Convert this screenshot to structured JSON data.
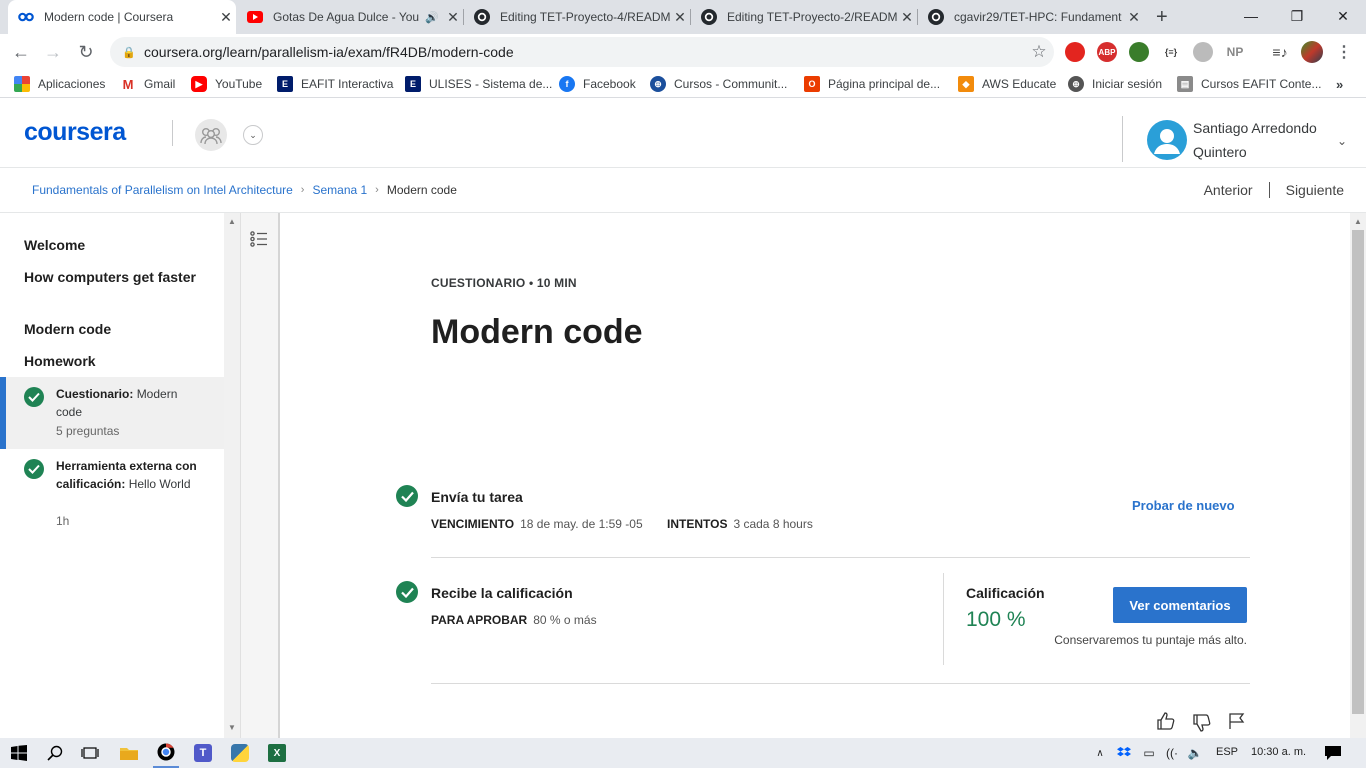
{
  "browser": {
    "tabs": [
      {
        "title": "Modern code | Coursera",
        "icon": "coursera-icon",
        "active": true
      },
      {
        "title": "Gotas De Agua Dulce - You",
        "icon": "youtube-icon",
        "audio": true
      },
      {
        "title": "Editing TET-Proyecto-4/READM",
        "icon": "github-icon"
      },
      {
        "title": "Editing TET-Proyecto-2/READM",
        "icon": "github-icon"
      },
      {
        "title": "cgavir29/TET-HPC: Fundament",
        "icon": "github-icon"
      }
    ],
    "url": "coursera.org/learn/parallelism-ia/exam/fR4DB/modern-code",
    "bookmarks": [
      {
        "label": "Aplicaciones",
        "icon": "apps-grid-icon"
      },
      {
        "label": "Gmail",
        "icon": "gmail-icon"
      },
      {
        "label": "YouTube",
        "icon": "youtube-icon"
      },
      {
        "label": "EAFIT Interactiva",
        "icon": "eafit-icon"
      },
      {
        "label": "ULISES - Sistema de...",
        "icon": "eafit-icon"
      },
      {
        "label": "Facebook",
        "icon": "facebook-icon"
      },
      {
        "label": "Cursos - Communit...",
        "icon": "globe-icon"
      },
      {
        "label": "Página principal de...",
        "icon": "office-icon"
      },
      {
        "label": "AWS Educate",
        "icon": "aws-icon"
      },
      {
        "label": "Iniciar sesión",
        "icon": "globe-icon"
      },
      {
        "label": "Cursos EAFIT Conte...",
        "icon": "page-icon"
      }
    ],
    "extensions": {
      "abp": "ABP",
      "np": "NP",
      "braces": "{≡}"
    }
  },
  "header": {
    "logo": "coursera",
    "user_name": "Santiago Arredondo Quintero"
  },
  "breadcrumb": {
    "course": "Fundamentals of Parallelism on Intel Architecture",
    "week": "Semana 1",
    "current": "Modern code"
  },
  "nav": {
    "prev": "Anterior",
    "next": "Siguiente"
  },
  "sidebar": {
    "sections": [
      "Welcome",
      "How computers get faster",
      "Modern code",
      "Homework"
    ],
    "items": [
      {
        "type": "Cuestionario:",
        "name": "Modern code",
        "meta": "5 preguntas",
        "selected": true
      },
      {
        "type": "Herramienta externa con calificación:",
        "name": "Hello World",
        "meta": "1h",
        "selected": false
      }
    ]
  },
  "main": {
    "kicker": "CUESTIONARIO • 10 MIN",
    "title": "Modern code",
    "submit": {
      "title": "Envía tu tarea",
      "due_label": "VENCIMIENTO",
      "due_value": "18 de may. de 1:59 -05",
      "attempts_label": "INTENTOS",
      "attempts_value": "3 cada 8 hours",
      "retry": "Probar de nuevo"
    },
    "grade": {
      "title": "Recibe la calificación",
      "pass_label": "PARA APROBAR",
      "pass_value": "80 % o más",
      "grade_label": "Calificación",
      "grade_value": "100 %",
      "button": "Ver comentarios",
      "note": "Conservaremos tu puntaje más alto."
    }
  },
  "taskbar": {
    "lang": "ESP",
    "time": "10:30 a. m."
  },
  "colors": {
    "brand": "#0056d2",
    "link": "#2a73cc",
    "success": "#1f8354"
  }
}
